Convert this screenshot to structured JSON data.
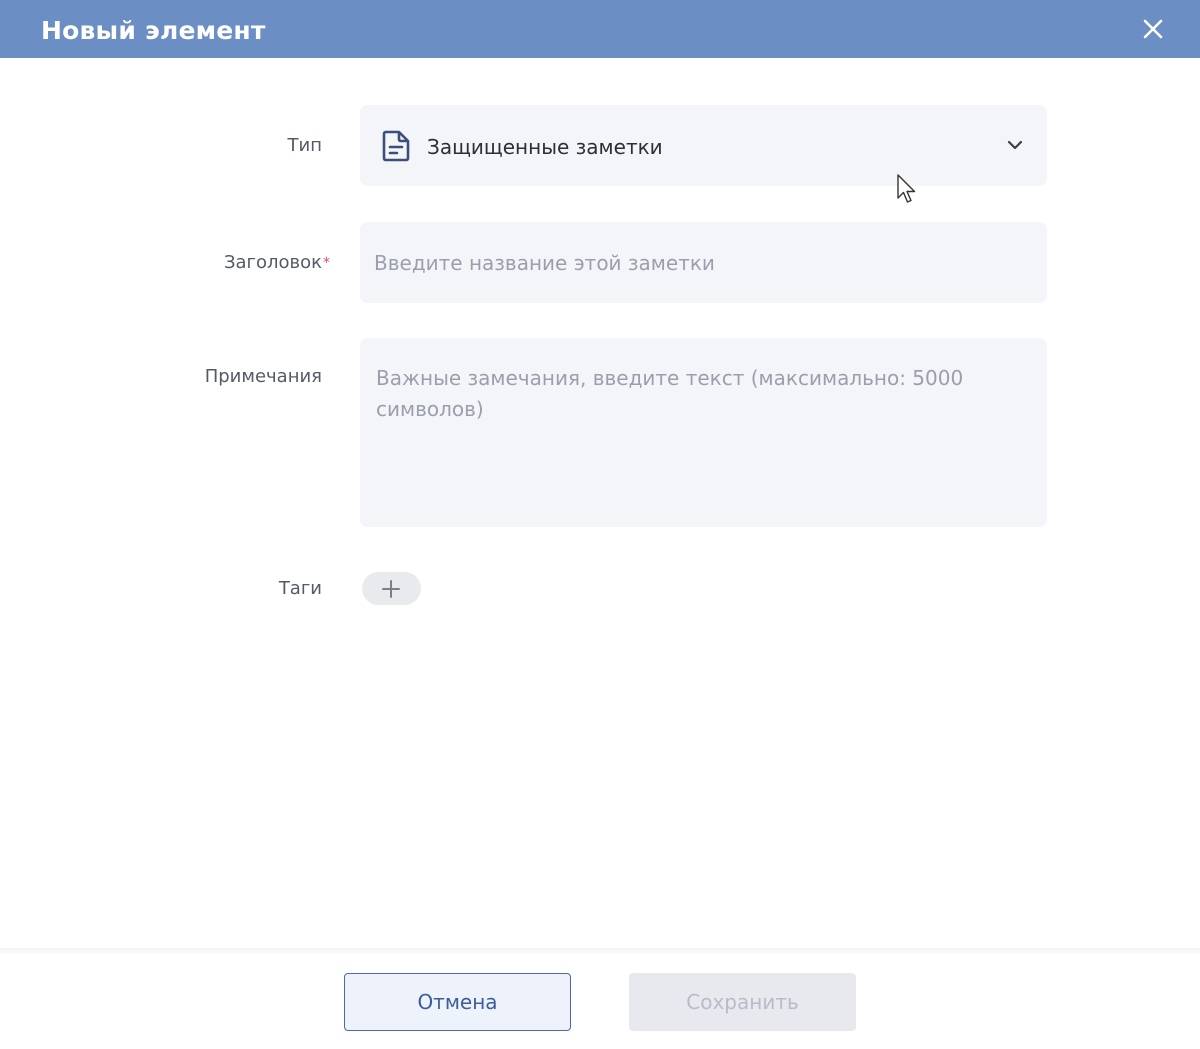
{
  "dialog": {
    "title": "Новый элемент",
    "close_icon": "close-icon"
  },
  "form": {
    "type": {
      "label": "Тип",
      "value": "Защищенные заметки",
      "icon": "document-icon"
    },
    "title_field": {
      "label": "Заголовок",
      "required_mark": "*",
      "value": "",
      "placeholder": "Введите название этой заметки"
    },
    "notes": {
      "label": "Примечания",
      "value": "",
      "placeholder": "Важные замечания, введите текст (максимально: 5000 символов)"
    },
    "tags": {
      "label": "Таги",
      "add_icon": "plus-icon"
    }
  },
  "footer": {
    "cancel_label": "Отмена",
    "save_label": "Сохранить"
  },
  "colors": {
    "title_bar": "#6b8ec5",
    "field_bg": "#f4f5f9",
    "required": "#e54d5b",
    "primary_border": "#4d6aa6",
    "disabled_text": "#b6bcc8"
  }
}
